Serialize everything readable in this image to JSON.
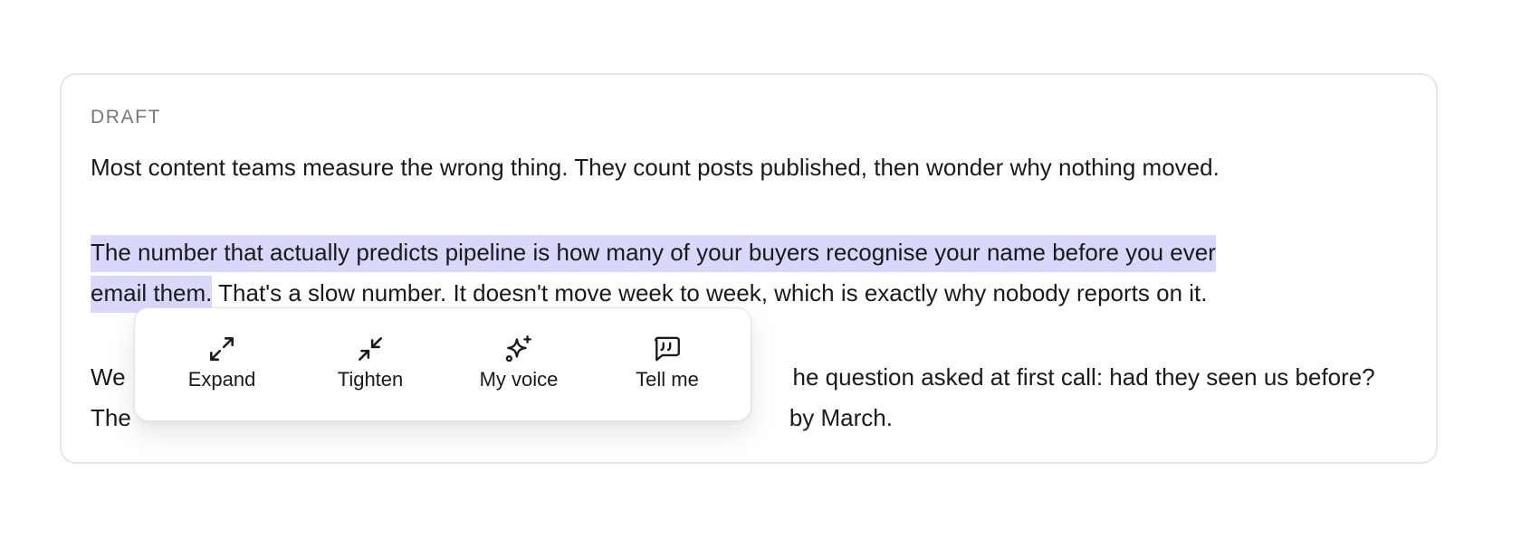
{
  "card": {
    "section_label": "DRAFT"
  },
  "paragraphs": {
    "p1": "Most content teams measure the wrong thing. They count posts published, then wonder why nothing moved.",
    "p2_highlight_line1": "The number that actually predicts pipeline is how many of your buyers recognise your name before you ever",
    "p2_highlight_line2": "email them.",
    "p2_rest": " That's a slow number. It doesn't move week to week, which is exactly why nobody reports on it.",
    "p3_line1_start": "We",
    "p3_line1_end": "he question asked at first call: had they seen us before?",
    "p3_line2_start": "The",
    "p3_line2_end": "by March."
  },
  "toolbar": {
    "items": [
      {
        "label": "Expand",
        "icon": "expand-arrows-icon"
      },
      {
        "label": "Tighten",
        "icon": "collapse-arrows-icon"
      },
      {
        "label": "My voice",
        "icon": "sparkle-icon"
      },
      {
        "label": "Tell me",
        "icon": "quote-bubble-icon"
      }
    ]
  },
  "colors": {
    "highlight": "#d9d7fb",
    "text": "#1a1a1a",
    "muted_label": "#777777",
    "card_border": "#e6e6e6"
  }
}
